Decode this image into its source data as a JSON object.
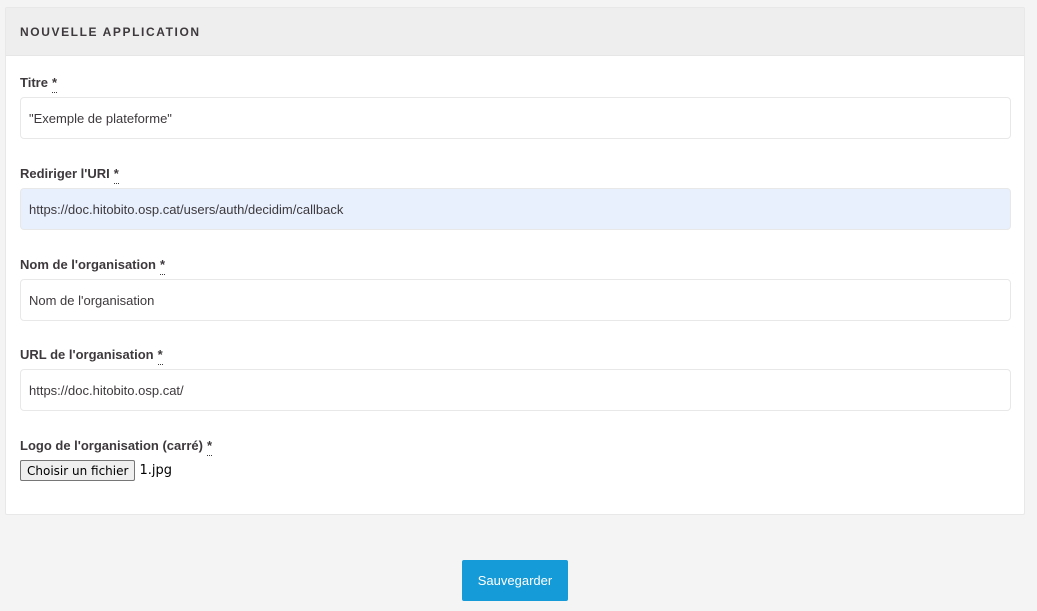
{
  "form": {
    "title": "NOUVELLE APPLICATION",
    "required_marker": "*",
    "fields": {
      "titre": {
        "label": "Titre",
        "value": "\"Exemple de plateforme\""
      },
      "redirect_uri": {
        "label": "Rediriger l'URI",
        "value": "https://doc.hitobito.osp.cat/users/auth/decidim/callback"
      },
      "org_name": {
        "label": "Nom de l'organisation",
        "value": "Nom de l'organisation"
      },
      "org_url": {
        "label": "URL de l'organisation",
        "value": "https://doc.hitobito.osp.cat/"
      },
      "org_logo": {
        "label": "Logo de l'organisation (carré)",
        "button_label": "Choisir un fichier",
        "file_name": "1.jpg"
      }
    },
    "submit_label": "Sauvegarder"
  },
  "colors": {
    "page_background": "#f4f4f4",
    "header_background": "#eeeeee",
    "autofill_background": "#e8f0fe",
    "primary_button": "#169bd9"
  }
}
